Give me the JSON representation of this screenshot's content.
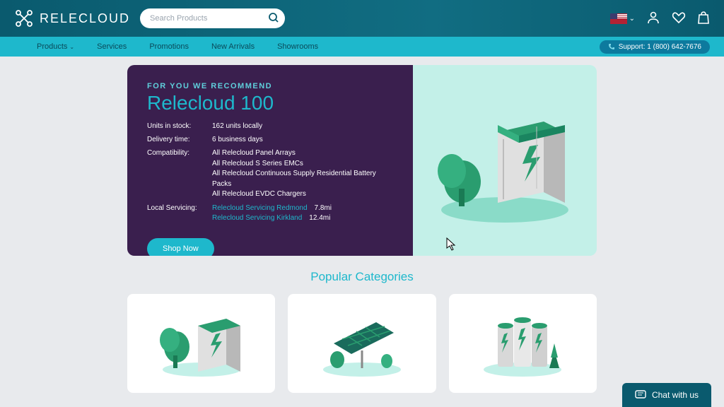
{
  "brand": "RELECLOUD",
  "search": {
    "placeholder": "Search Products"
  },
  "nav": {
    "items": [
      "Products",
      "Services",
      "Promotions",
      "New Arrivals",
      "Showrooms"
    ],
    "support_label": "Support: 1 (800) 642-7676"
  },
  "hero": {
    "eyebrow": "FOR YOU WE RECOMMEND",
    "title": "Relecloud 100",
    "specs": {
      "units_label": "Units in stock:",
      "units_value": "162 units locally",
      "delivery_label": "Delivery time:",
      "delivery_value": "6 business days",
      "compat_label": "Compatibility:",
      "compat_lines": [
        "All Relecloud Panel Arrays",
        "All Relecloud S Series EMCs",
        "All Relecloud Continuous Supply Residential Battery Packs",
        "All Relecloud EVDC Chargers"
      ],
      "servicing_label": "Local Servicing:",
      "servicing": [
        {
          "name": "Relecloud Servicing Redmond",
          "dist": "7.8mi"
        },
        {
          "name": "Relecloud Servicing Kirkland",
          "dist": "12.4mi"
        }
      ]
    },
    "cta": "Shop Now"
  },
  "popular_title": "Popular Categories",
  "chat": "Chat with us"
}
